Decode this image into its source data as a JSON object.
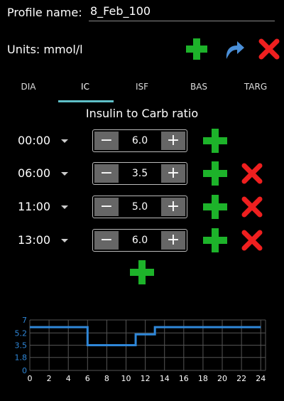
{
  "profile": {
    "label": "Profile name:",
    "value": "8_Feb_100"
  },
  "units": {
    "label": "Units: mmol/l"
  },
  "top_actions": {
    "add": "plus-icon",
    "redo": "redo-arrow-icon",
    "delete": "close-icon"
  },
  "tabs": [
    {
      "label": "DIA",
      "active": false
    },
    {
      "label": "IC",
      "active": true
    },
    {
      "label": "ISF",
      "active": false
    },
    {
      "label": "BAS",
      "active": false
    },
    {
      "label": "TARG",
      "active": false
    }
  ],
  "section_title": "Insulin to Carb ratio",
  "rows": [
    {
      "time": "00:00",
      "value": "6.0",
      "deletable": false
    },
    {
      "time": "06:00",
      "value": "3.5",
      "deletable": true
    },
    {
      "time": "11:00",
      "value": "5.0",
      "deletable": true
    },
    {
      "time": "13:00",
      "value": "6.0",
      "deletable": true
    }
  ],
  "stepper": {
    "minus": "−",
    "plus": "+"
  },
  "colors": {
    "accent_green": "#1db32a",
    "delete_red": "#ef1f1f",
    "redo_blue": "#4a8fd8",
    "tab_underline": "#5fc0c8",
    "chart_line": "#2f87d8",
    "grid": "#555555"
  },
  "chart_data": {
    "type": "line",
    "x": [
      0,
      6,
      6,
      11,
      11,
      13,
      13,
      24
    ],
    "values": [
      6.0,
      6.0,
      3.5,
      3.5,
      5.0,
      5.0,
      6.0,
      6.0
    ],
    "xticks": [
      "0",
      "2",
      "4",
      "6",
      "8",
      "10",
      "12",
      "14",
      "16",
      "18",
      "20",
      "22",
      "24"
    ],
    "yticks": [
      "0",
      "1.8",
      "3.5",
      "5.2",
      "7"
    ],
    "xlim": [
      0,
      24.5
    ],
    "ylim": [
      0,
      7
    ],
    "grid": true
  }
}
